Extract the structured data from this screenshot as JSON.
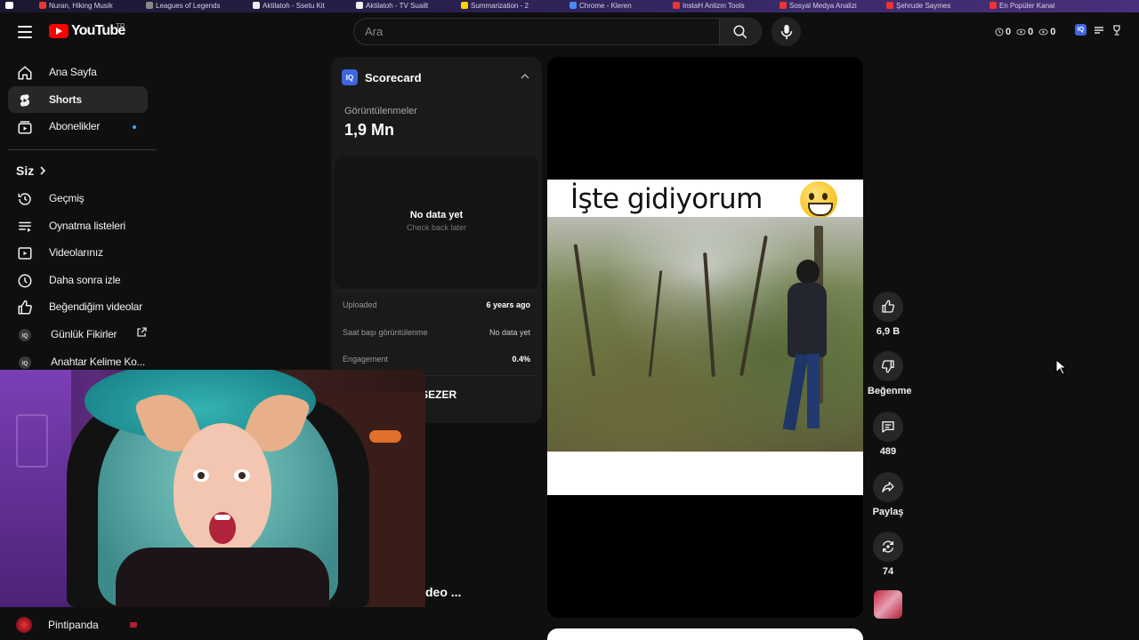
{
  "topbar": {
    "logo_text": "YouTube",
    "logo_country": "TR",
    "search_placeholder": "Ara",
    "ext_stats": [
      "0",
      "0",
      "0"
    ]
  },
  "bookmarks": [
    "Nuran, Hiking Musik",
    "Leagues of Legends",
    "Aktilatoh - Ssetu Kit",
    "Aktilatoh - TV Suailt",
    "Summarization - 2",
    "Chrome - Kleren",
    "InstaH Anlizm Tools",
    "Sosyal Medya Analizi",
    "Şehrude Saymes",
    "En Popüler Kanal"
  ],
  "sidebar": {
    "items_top": [
      {
        "label": "Ana Sayfa",
        "icon": "home-icon"
      },
      {
        "label": "Shorts",
        "icon": "shorts-icon",
        "active": true
      },
      {
        "label": "Abonelikler",
        "icon": "subscriptions-icon",
        "dot": true
      }
    ],
    "you_label": "Siz",
    "items_you": [
      {
        "label": "Geçmiş",
        "icon": "history-icon"
      },
      {
        "label": "Oynatma listeleri",
        "icon": "playlists-icon"
      },
      {
        "label": "Videolarınız",
        "icon": "your-videos-icon"
      },
      {
        "label": "Daha sonra izle",
        "icon": "watch-later-icon"
      },
      {
        "label": "Beğendiğim videolar",
        "icon": "liked-videos-icon"
      },
      {
        "label": "Günlük Fikirler",
        "icon": "vidiq-icon",
        "external": true
      },
      {
        "label": "Anahtar Kelime Ko...",
        "icon": "vidiq-icon"
      }
    ],
    "bottom_channel": "Pintipanda"
  },
  "scorecard": {
    "title": "Scorecard",
    "views_label": "Görüntülenmeler",
    "views_value": "1,9 Mn",
    "no_data_title": "No data yet",
    "no_data_sub": "Check back later",
    "rows": [
      {
        "key": "Uploaded",
        "value": "6 years ago"
      },
      {
        "key": "Saat başı görüntülenme",
        "value": "No data yet"
      },
      {
        "key": "Engagement",
        "value": "0.4%"
      }
    ],
    "channel_name_fragment": "ÜL SEZER"
  },
  "video_title_fragment": "deo ...",
  "short": {
    "caption": "İşte gidiyorum"
  },
  "actions": {
    "like_count": "6,9 B",
    "dislike_label": "Beğenme",
    "comment_count": "489",
    "share_label": "Paylaş",
    "remix_count": "74"
  }
}
